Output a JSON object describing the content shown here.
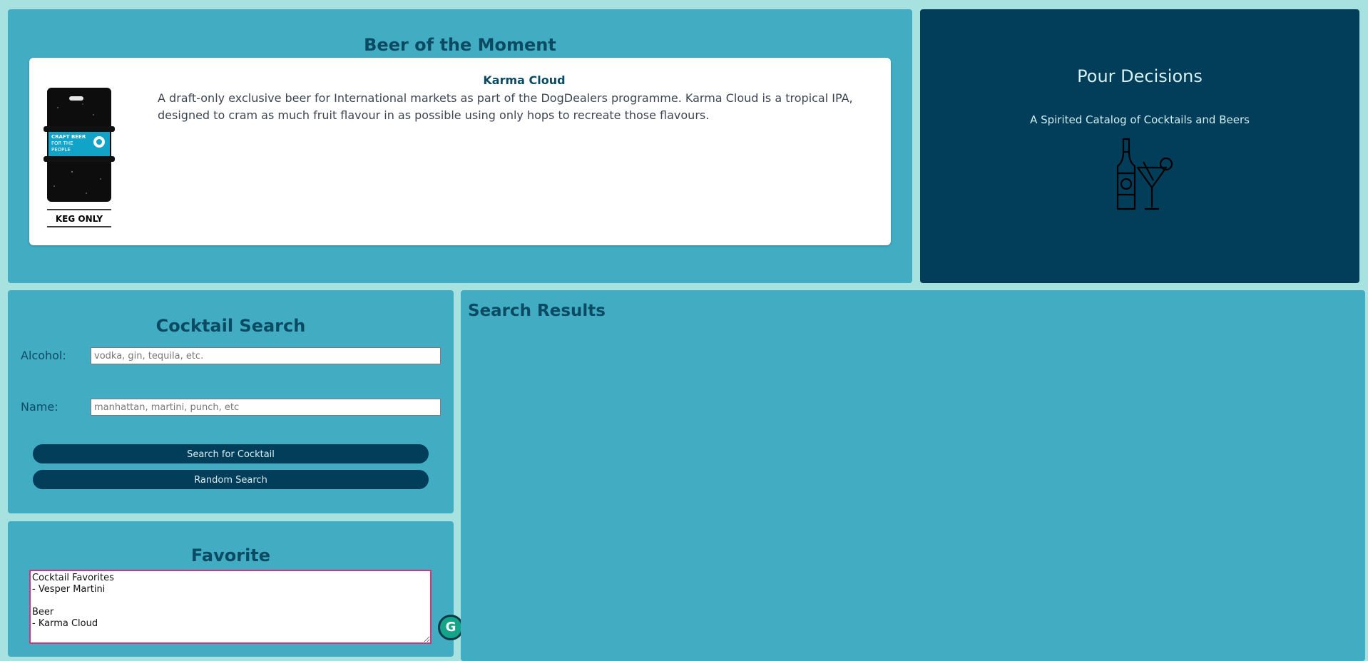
{
  "beer_of_moment": {
    "title": "Beer of the Moment",
    "beer_name": "Karma Cloud",
    "description": "A draft-only exclusive beer for International markets as part of the DogDealers programme. Karma Cloud is a tropical IPA, designed to cram as much fruit flavour in as possible using only hops to recreate those flavours.",
    "image_text": {
      "label_line1": "CRAFT BEER",
      "label_line2": "FOR THE",
      "label_line3": "PEOPLE",
      "keg_label": "KEG ONLY"
    }
  },
  "brand": {
    "title": "Pour Decisions",
    "tagline": "A Spirited Catalog of Cocktails and Beers",
    "logo_icon": "bottle-and-martini-icon"
  },
  "cocktail_search": {
    "title": "Cocktail Search",
    "alcohol_label": "Alcohol:",
    "alcohol_placeholder": "vodka, gin, tequila, etc.",
    "alcohol_value": "",
    "name_label": "Name:",
    "name_placeholder": "manhattan, martini, punch, etc",
    "name_value": "",
    "search_button": "Search for Cocktail",
    "random_button": "Random Search"
  },
  "favorite": {
    "title": "Favorite",
    "text": "Cocktail Favorites\n- Vesper Martini\n\nBeer\n- Karma Cloud"
  },
  "results": {
    "title": "Search Results"
  },
  "colors": {
    "page_bg": "#a7e1e0",
    "panel_bg": "#42adc2",
    "dark_panel": "#023e5a",
    "heading": "#0b4a63",
    "focus_border": "#d6337a"
  }
}
